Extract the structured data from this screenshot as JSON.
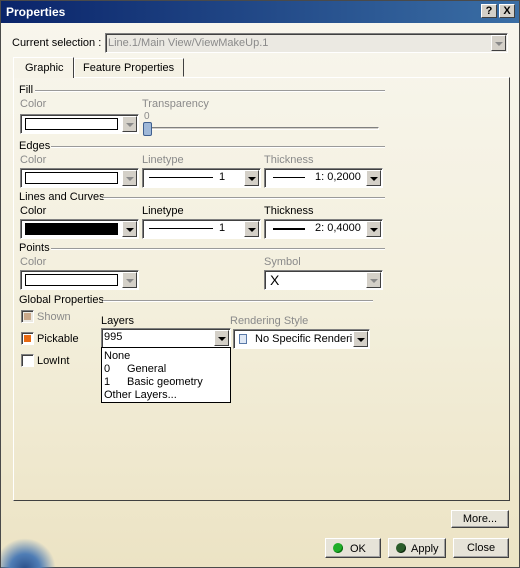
{
  "window": {
    "title": "Properties",
    "help_btn": "?",
    "close_btn": "X"
  },
  "current_selection": {
    "label": "Current selection :",
    "value": "Line.1/Main View/ViewMakeUp.1"
  },
  "tabs": [
    {
      "label": "Graphic"
    },
    {
      "label": "Feature Properties"
    }
  ],
  "fill": {
    "section": "Fill",
    "color_label": "Color",
    "transparency_label": "Transparency",
    "transparency_value": "0",
    "color": "#ffffff"
  },
  "edges": {
    "section": "Edges",
    "color_label": "Color",
    "linetype_label": "Linetype",
    "thickness_label": "Thickness",
    "color": "#ffffff",
    "linetype_value": "1",
    "thickness_value": "1: 0,2000"
  },
  "lines_curves": {
    "section": "Lines and Curves",
    "color_label": "Color",
    "linetype_label": "Linetype",
    "thickness_label": "Thickness",
    "color": "#000000",
    "linetype_value": "1",
    "thickness_value": "2: 0,4000"
  },
  "points": {
    "section": "Points",
    "color_label": "Color",
    "symbol_label": "Symbol",
    "color": "#ffffff",
    "symbol_value": "X"
  },
  "global": {
    "section": "Global Properties",
    "shown_label": "Shown",
    "pickable_label": "Pickable",
    "lowint_label": "LowInt",
    "layers_label": "Layers",
    "layers_value": "995",
    "layers_options": [
      {
        "num": "",
        "name": "None"
      },
      {
        "num": "0",
        "name": "General"
      },
      {
        "num": "1",
        "name": "Basic geometry"
      },
      {
        "num": "",
        "name": "Other Layers..."
      }
    ],
    "rendering_label": "Rendering Style",
    "rendering_value": "No Specific Renderin"
  },
  "buttons": {
    "more": "More...",
    "ok": "OK",
    "apply": "Apply",
    "close": "Close"
  },
  "colors": {
    "titlebar_start": "#0a246a",
    "titlebar_end": "#3a6ea5",
    "pickable_check": "#e86a12",
    "ok_led": "#1fae2a",
    "apply_led": "#2a5c2a"
  }
}
